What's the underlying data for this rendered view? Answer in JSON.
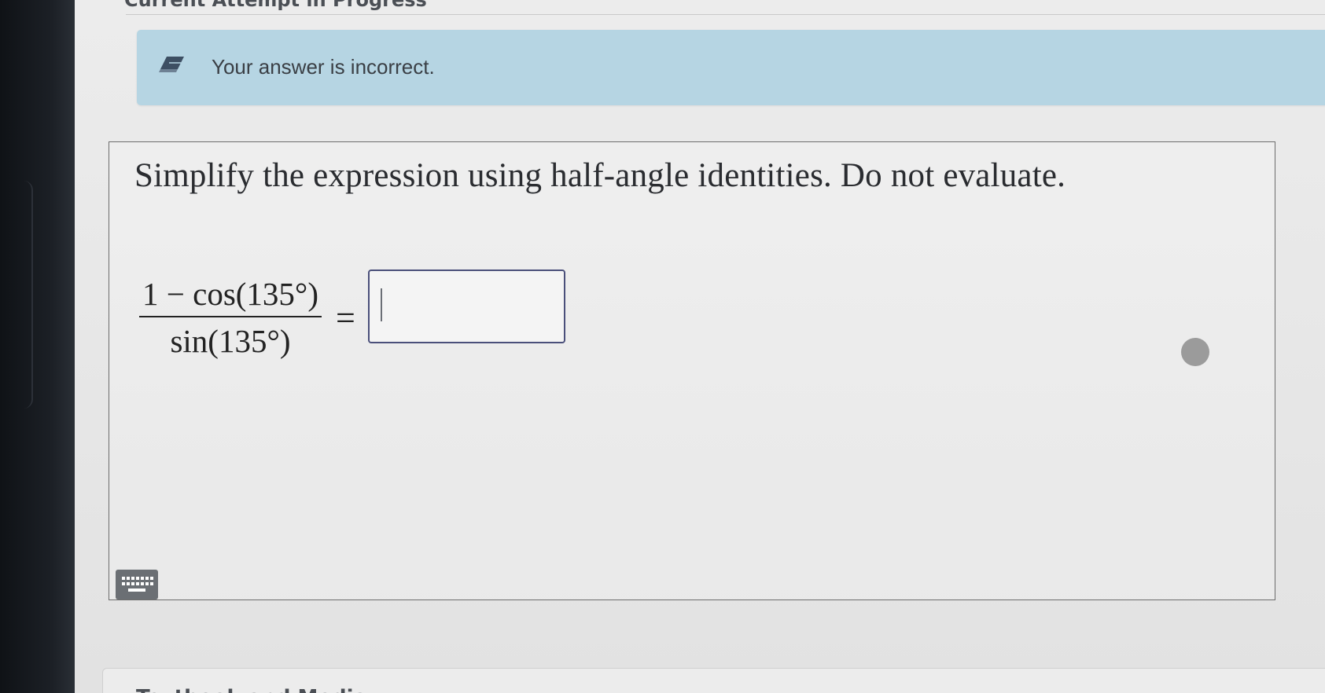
{
  "header": {
    "progress_label": "Current Attempt in Progress"
  },
  "feedback": {
    "icon": "eraser-icon",
    "message": "Your answer is incorrect.",
    "background_color": "#b6d5e3"
  },
  "question": {
    "prompt": "Simplify the expression using half-angle identities. Do not evaluate.",
    "expression": {
      "numerator": "1 − cos(135°)",
      "denominator": "sin(135°)",
      "equals": "="
    },
    "answer": {
      "value": ""
    },
    "status_icon": "circle-indicator-icon",
    "keyboard_icon": "keyboard-icon"
  },
  "footer": {
    "card_title": "Textbook and Media"
  }
}
